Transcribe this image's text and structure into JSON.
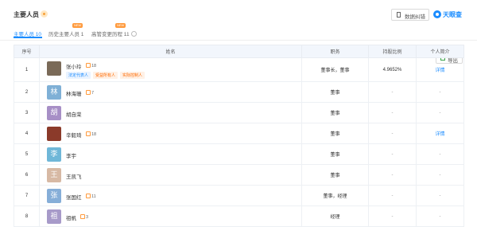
{
  "header": {
    "title": "主要人员",
    "correct_label": "数据纠错",
    "logo": "天眼查"
  },
  "tabs": [
    {
      "label": "主要人员 10"
    },
    {
      "label": "历史主要人员 1",
      "badge": "NEW"
    },
    {
      "label": "高管变更历程 11",
      "badge": "NEW"
    }
  ],
  "export_label": "导出",
  "table": {
    "headers": [
      "序号",
      "姓名",
      "职务",
      "持股比例",
      "个人简介"
    ],
    "rows": [
      {
        "no": "1",
        "avatar": "",
        "avatar_color": "#7a6a58",
        "name": "张小玲",
        "count": "18",
        "tags": [
          {
            "text": "法定代表人",
            "style": "blue"
          },
          {
            "text": "受益所有人",
            "style": "orange"
          },
          {
            "text": "实际控制人",
            "style": "orange"
          }
        ],
        "position": "董事长，董事",
        "share": "4.9652%",
        "profile": "详情"
      },
      {
        "no": "2",
        "avatar": "林",
        "avatar_color": "#7fb0d6",
        "name": "林海珊",
        "count": "7",
        "tags": [],
        "position": "董事",
        "share": "-",
        "profile": "-"
      },
      {
        "no": "3",
        "avatar": "胡",
        "avatar_color": "#a78fc6",
        "name": "胡自荣",
        "count": "",
        "tags": [],
        "position": "董事",
        "share": "-",
        "profile": "-"
      },
      {
        "no": "4",
        "avatar": "",
        "avatar_color": "#8b3a2a",
        "name": "辛毅琦",
        "count": "18",
        "tags": [],
        "position": "董事",
        "share": "-",
        "profile": "详情"
      },
      {
        "no": "5",
        "avatar": "李",
        "avatar_color": "#6fb7d8",
        "name": "李宇",
        "count": "",
        "tags": [],
        "position": "董事",
        "share": "-",
        "profile": "-"
      },
      {
        "no": "6",
        "avatar": "王",
        "avatar_color": "#d7b9a4",
        "name": "王凯飞",
        "count": "",
        "tags": [],
        "position": "董事",
        "share": "-",
        "profile": "-"
      },
      {
        "no": "7",
        "avatar": "张",
        "avatar_color": "#86aed8",
        "name": "张国红",
        "count": "11",
        "tags": [],
        "position": "董事，经理",
        "share": "-",
        "profile": "-"
      },
      {
        "no": "8",
        "avatar": "祖",
        "avatar_color": "#a79ac9",
        "name": "祖帆",
        "count": "3",
        "tags": [],
        "position": "经理",
        "share": "-",
        "profile": "-"
      }
    ]
  }
}
